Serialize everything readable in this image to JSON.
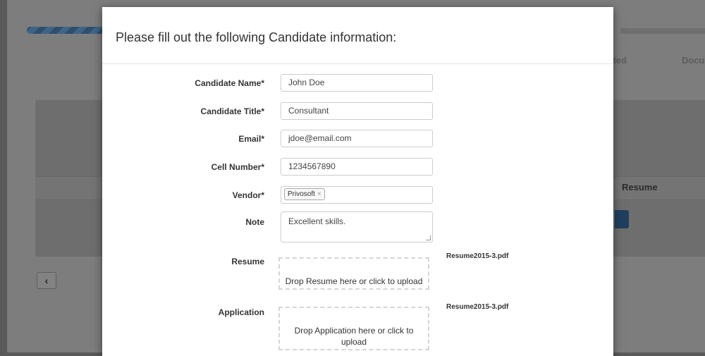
{
  "background": {
    "steps": [
      "ected",
      "Docu"
    ],
    "table_header_resume": "Resume",
    "prev_button_icon": "chevron-left"
  },
  "modal": {
    "title": "Please fill out the following Candidate information:",
    "fields": {
      "name": {
        "label": "Candidate Name*",
        "value": "John Doe"
      },
      "title": {
        "label": "Candidate Title*",
        "value": "Consultant"
      },
      "email": {
        "label": "Email*",
        "value": "jdoe@email.com"
      },
      "cell": {
        "label": "Cell Number*",
        "value": "1234567890"
      },
      "vendor": {
        "label": "Vendor*",
        "tag": "Privosoft",
        "tag_remove": "×"
      },
      "note": {
        "label": "Note",
        "value": "Excellent skills."
      }
    },
    "uploads": {
      "resume": {
        "label": "Resume",
        "dropzone_text": "Drop Resume here or click to upload",
        "file": "Resume2015-3.pdf"
      },
      "application": {
        "label": "Application",
        "dropzone_text": "Drop Application here or click to upload",
        "file": "Resume2015-3.pdf"
      }
    }
  },
  "colors": {
    "overlay": "#7d7d7d",
    "progress_accent": "#2f4e6b",
    "modal_bg": "#ffffff"
  }
}
